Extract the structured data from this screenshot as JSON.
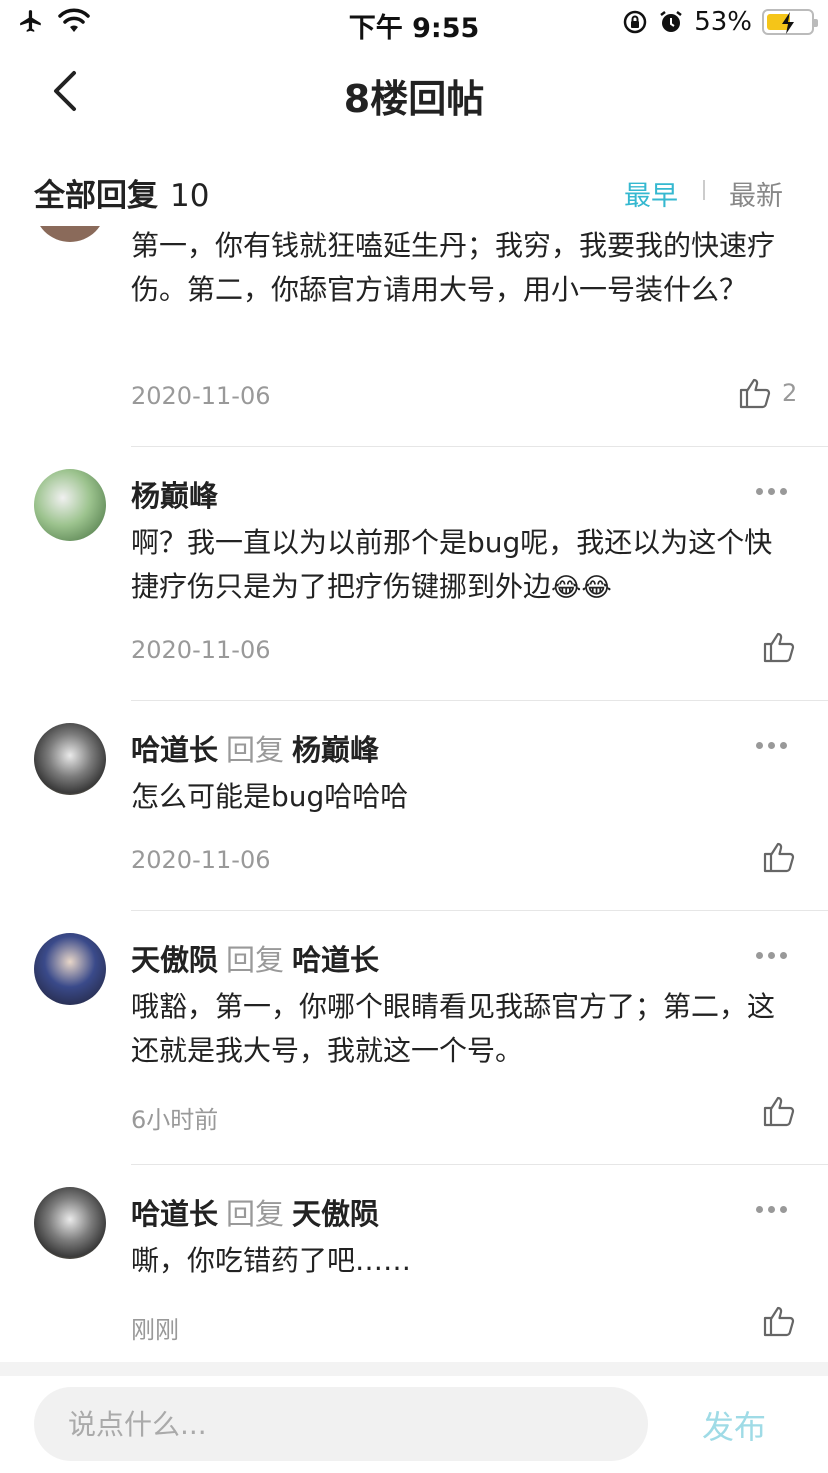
{
  "status_bar": {
    "time": "下午 9:55",
    "battery_pct": "53%",
    "battery_level": 0.53
  },
  "nav": {
    "title": "8楼回帖"
  },
  "replies_header": {
    "title": "全部回复",
    "count": "10",
    "sort_earliest": "最早",
    "sort_latest": "最新"
  },
  "reply_word": "回复",
  "replies": [
    {
      "content": "第一，你有钱就狂嗑延生丹；我穷，我要我的快速疗伤。第二，你舔官方请用大号，用小一号装什么？",
      "date": "2020-11-06",
      "likes": "2"
    },
    {
      "user": "杨巅峰",
      "content": "啊？我一直以为以前那个是bug呢，我还以为这个快捷疗伤只是为了把疗伤键挪到外边",
      "emoji": "😂😂",
      "date": "2020-11-06"
    },
    {
      "user": "哈道长",
      "reply_to": "杨巅峰",
      "content": "怎么可能是bug哈哈哈",
      "date": "2020-11-06"
    },
    {
      "user": "天傲陨",
      "reply_to": "哈道长",
      "content": "哦豁，第一，你哪个眼睛看见我舔官方了；第二，这还就是我大号，我就这一个号。",
      "date": "6小时前"
    },
    {
      "user": "哈道长",
      "reply_to": "天傲陨",
      "content": "嘶，你吃错药了吧……",
      "date": "刚刚"
    }
  ],
  "input": {
    "placeholder": "说点什么..."
  },
  "publish_label": "发布",
  "colors": {
    "accent": "#35b8d0",
    "publish_disabled": "#9fdbe6",
    "muted": "#999999"
  }
}
